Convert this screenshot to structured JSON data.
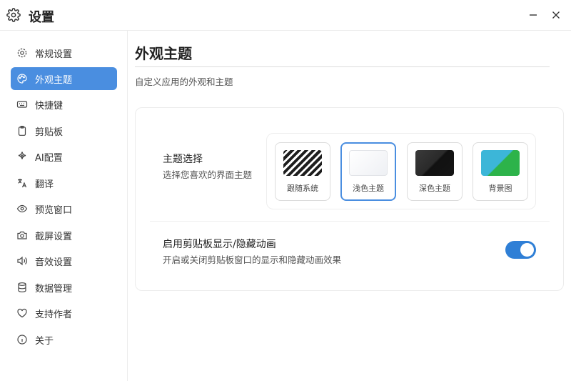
{
  "window": {
    "title": "设置"
  },
  "sidebar": {
    "items": [
      {
        "label": "常规设置",
        "icon": "gear-icon"
      },
      {
        "label": "外观主题",
        "icon": "palette-icon",
        "active": true
      },
      {
        "label": "快捷键",
        "icon": "keyboard-icon"
      },
      {
        "label": "剪贴板",
        "icon": "clipboard-icon"
      },
      {
        "label": "AI配置",
        "icon": "ai-icon"
      },
      {
        "label": "翻译",
        "icon": "translate-icon"
      },
      {
        "label": "预览窗口",
        "icon": "eye-icon"
      },
      {
        "label": "截屏设置",
        "icon": "camera-icon"
      },
      {
        "label": "音效设置",
        "icon": "speaker-icon"
      },
      {
        "label": "数据管理",
        "icon": "database-icon"
      },
      {
        "label": "支持作者",
        "icon": "heart-icon"
      },
      {
        "label": "关于",
        "icon": "info-icon"
      }
    ]
  },
  "main": {
    "title": "外观主题",
    "subtitle": "自定义应用的外观和主题",
    "theme_section": {
      "title": "主题选择",
      "desc": "选择您喜欢的界面主题",
      "options": [
        {
          "label": "跟随系统"
        },
        {
          "label": "浅色主题",
          "selected": true
        },
        {
          "label": "深色主题"
        },
        {
          "label": "背景图"
        }
      ]
    },
    "animation_section": {
      "title": "启用剪贴板显示/隐藏动画",
      "desc": "开启或关闭剪贴板窗口的显示和隐藏动画效果",
      "enabled": true
    }
  },
  "colors": {
    "accent": "#4a8ee0",
    "toggle_on": "#2f7fd6"
  }
}
